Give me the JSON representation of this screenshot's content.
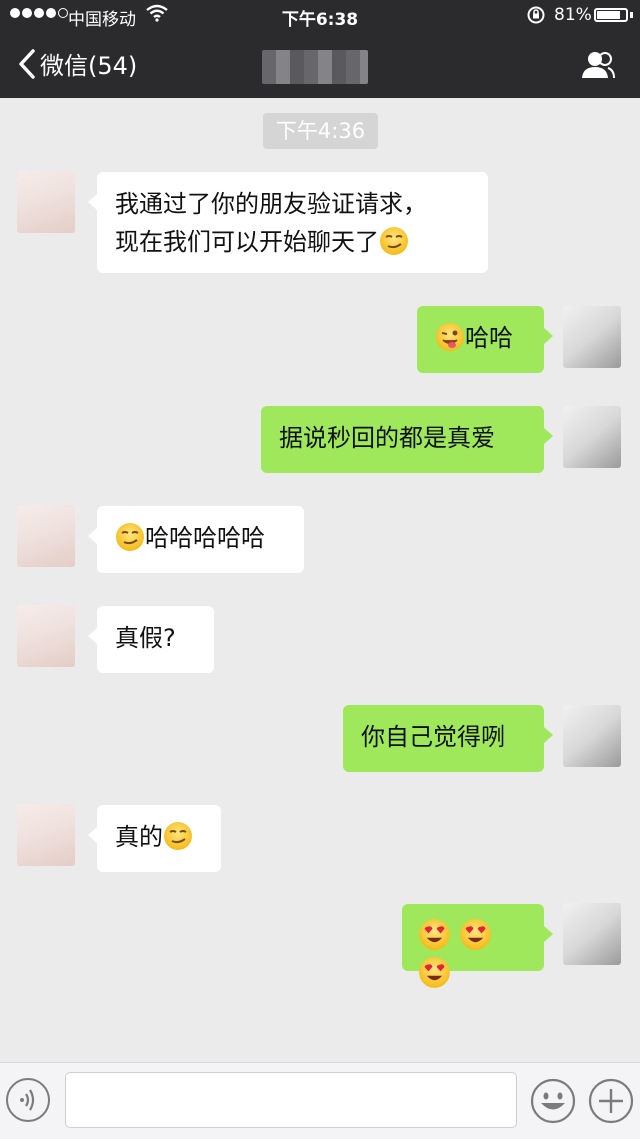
{
  "status_bar": {
    "carrier": "中国移动",
    "time": "下午6:38",
    "battery_percent": "81%",
    "battery_level": 0.81,
    "signal_dots_filled": 4,
    "signal_dots_total": 5
  },
  "nav": {
    "back_label": "微信(54)",
    "back_icon": "chevron-left-icon",
    "contact_icon": "contact-info-icon"
  },
  "timestamp": "下午4:36",
  "messages": [
    {
      "side": "left",
      "line1": "我通过了你的朋友验证请求，",
      "line2": "现在我们可以开始聊天了",
      "emoji": "smug-face"
    },
    {
      "side": "right",
      "text": "哈哈",
      "emoji": "winking-tongue-face"
    },
    {
      "side": "right",
      "text": "据说秒回的都是真爱"
    },
    {
      "side": "left",
      "text": "哈哈哈哈哈",
      "emoji": "smug-face"
    },
    {
      "side": "left",
      "text": "真假?"
    },
    {
      "side": "right",
      "text": "你自己觉得咧"
    },
    {
      "side": "left",
      "text": "真的",
      "emoji": "smug-face"
    },
    {
      "side": "right",
      "emoji": "heart-eyes-face x3"
    }
  ],
  "input_bar": {
    "voice_icon": "voice-icon",
    "emoji_icon": "emoji-icon",
    "plus_icon": "plus-icon",
    "text_value": ""
  },
  "colors": {
    "nav_bg": "#2b2b2d",
    "chat_bg": "#ebebeb",
    "sent_bubble": "#9fe85b",
    "received_bubble": "#ffffff"
  }
}
